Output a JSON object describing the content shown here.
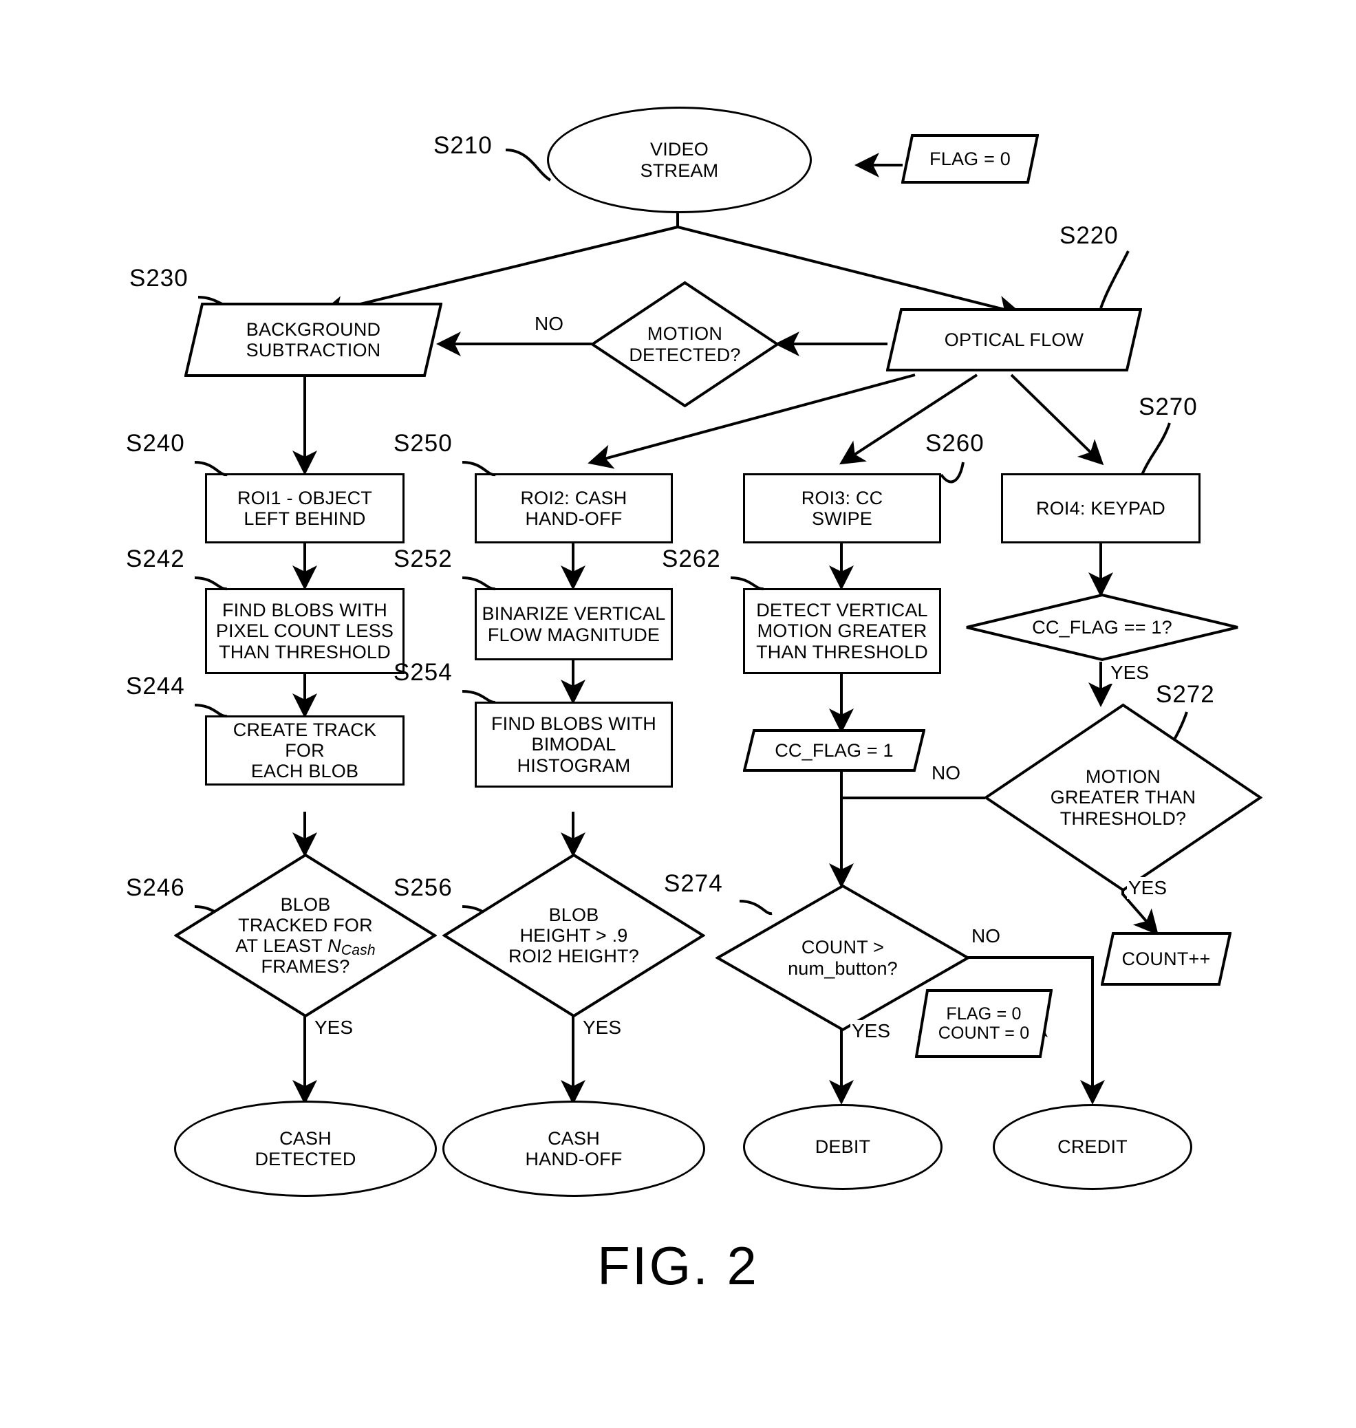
{
  "figure": {
    "caption": "FIG. 2"
  },
  "nodes": {
    "video_stream": {
      "label": "VIDEO\nSTREAM",
      "shape": "ellipse"
    },
    "flag_zero": {
      "label": "FLAG = 0",
      "shape": "parallelogram"
    },
    "background_subtraction": {
      "label": "BACKGROUND\nSUBTRACTION",
      "shape": "parallelogram"
    },
    "motion_detected": {
      "label": "MOTION\nDETECTED?",
      "shape": "diamond"
    },
    "optical_flow": {
      "label": "OPTICAL FLOW",
      "shape": "parallelogram"
    },
    "roi1": {
      "label": "ROI1 - OBJECT\nLEFT BEHIND",
      "shape": "rect"
    },
    "roi2": {
      "label": "ROI2: CASH\nHAND-OFF",
      "shape": "rect"
    },
    "roi3": {
      "label": "ROI3: CC\nSWIPE",
      "shape": "rect"
    },
    "roi4": {
      "label": "ROI4: KEYPAD",
      "shape": "rect"
    },
    "find_blobs_pixel": {
      "label": "FIND BLOBS WITH\nPIXEL COUNT LESS\nTHAN THRESHOLD",
      "shape": "rect"
    },
    "binarize_vertical": {
      "label": "BINARIZE VERTICAL\nFLOW MAGNITUDE",
      "shape": "rect"
    },
    "detect_vertical": {
      "label": "DETECT VERTICAL\nMOTION GREATER\nTHAN THRESHOLD",
      "shape": "rect"
    },
    "cc_flag_check": {
      "label": "CC_FLAG == 1?",
      "shape": "diamond"
    },
    "create_track": {
      "label": "CREATE TRACK FOR\nEACH BLOB",
      "shape": "rect"
    },
    "find_blobs_bimodal": {
      "label": "FIND BLOBS WITH\nBIMODAL\nHISTOGRAM",
      "shape": "rect"
    },
    "cc_flag_set": {
      "label": "CC_FLAG = 1",
      "shape": "parallelogram"
    },
    "motion_threshold": {
      "label": "MOTION\nGREATER THAN\nTHRESHOLD?",
      "shape": "diamond"
    },
    "blob_tracked": {
      "line1": "BLOB",
      "line2": "TRACKED FOR",
      "line3_pre": "AT LEAST ",
      "line3_var": "N",
      "line3_sub": "Cash",
      "line4": "FRAMES?",
      "shape": "diamond"
    },
    "blob_height": {
      "label": "BLOB\nHEIGHT > .9\nROI2 HEIGHT?",
      "shape": "diamond"
    },
    "count_check": {
      "label": "COUNT >\nnum_button?",
      "shape": "diamond"
    },
    "count_increment": {
      "label": "COUNT++",
      "shape": "parallelogram"
    },
    "flag_count_reset": {
      "label": "FLAG = 0\nCOUNT = 0",
      "shape": "parallelogram"
    },
    "cash_detected": {
      "label": "CASH\nDETECTED",
      "shape": "ellipse"
    },
    "cash_handoff": {
      "label": "CASH\nHAND-OFF",
      "shape": "ellipse"
    },
    "debit": {
      "label": "DEBIT",
      "shape": "ellipse"
    },
    "credit": {
      "label": "CREDIT",
      "shape": "ellipse"
    }
  },
  "step_labels": {
    "s210": "S210",
    "s220": "S220",
    "s230": "S230",
    "s240": "S240",
    "s242": "S242",
    "s244": "S244",
    "s246": "S246",
    "s250": "S250",
    "s252": "S252",
    "s254": "S254",
    "s256": "S256",
    "s260": "S260",
    "s262": "S262",
    "s270": "S270",
    "s272": "S272",
    "s274": "S274"
  },
  "edge_labels": {
    "motion_no": "NO",
    "cc_flag_yes": "YES",
    "cc_flag_no": "NO",
    "motion_threshold_yes": "YES",
    "blob_tracked_yes": "YES",
    "blob_height_yes": "YES",
    "count_no": "NO",
    "count_yes": "YES"
  },
  "colors": {
    "stroke": "#000000",
    "background": "#ffffff"
  }
}
